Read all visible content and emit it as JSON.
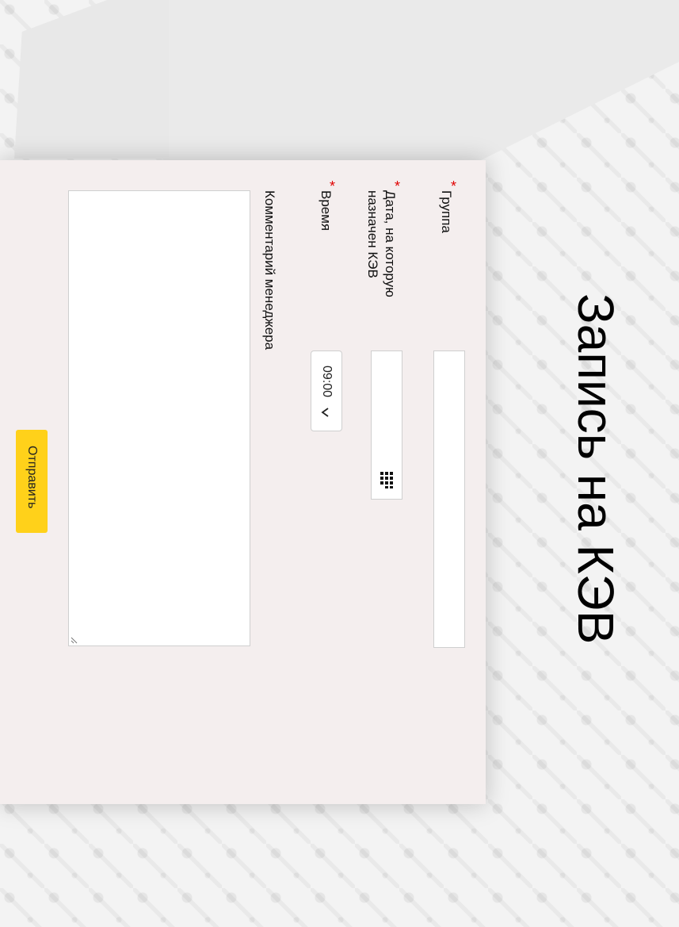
{
  "page": {
    "title": "Запись на КЭВ"
  },
  "form": {
    "group": {
      "label": "Группа",
      "required_mark": "*",
      "value": ""
    },
    "date": {
      "label_line1": "Дата, на которую",
      "label_line2": "назначен КЭВ",
      "required_mark": "*",
      "value": "",
      "icon": "calendar-icon"
    },
    "time": {
      "label": "Время",
      "required_mark": "*",
      "selected": "09:00",
      "icon": "chevron-down-icon"
    },
    "comment": {
      "label": "Комментарий менеджера",
      "value": ""
    },
    "submit_label": "Отправить"
  },
  "colors": {
    "accent": "#ffd11a",
    "required": "#e00000",
    "card_bg": "#f4eeee"
  }
}
